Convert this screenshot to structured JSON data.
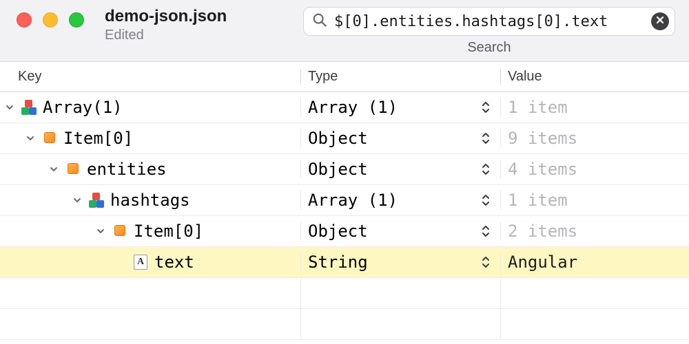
{
  "window": {
    "title": "demo-json.json",
    "subtitle": "Edited"
  },
  "search": {
    "value": "$[0].entities.hashtags[0].text",
    "label": "Search"
  },
  "columns": {
    "key": "Key",
    "type": "Type",
    "value": "Value"
  },
  "tree": [
    {
      "depth": 0,
      "icon": "cubes",
      "key": "Array(1)",
      "type": "Array (1)",
      "value": "1 item",
      "disclosure": true,
      "highlight": false,
      "strongValue": false
    },
    {
      "depth": 1,
      "icon": "box",
      "key": "Item[0]",
      "type": "Object",
      "value": "9 items",
      "disclosure": true,
      "highlight": false,
      "strongValue": false
    },
    {
      "depth": 2,
      "icon": "box",
      "key": "entities",
      "type": "Object",
      "value": "4 items",
      "disclosure": true,
      "highlight": false,
      "strongValue": false
    },
    {
      "depth": 3,
      "icon": "cubes",
      "key": "hashtags",
      "type": "Array (1)",
      "value": "1 item",
      "disclosure": true,
      "highlight": false,
      "strongValue": false
    },
    {
      "depth": 4,
      "icon": "box",
      "key": "Item[0]",
      "type": "Object",
      "value": "2 items",
      "disclosure": true,
      "highlight": false,
      "strongValue": false
    },
    {
      "depth": 5,
      "icon": "text",
      "key": "text",
      "type": "String",
      "value": "Angular",
      "disclosure": false,
      "highlight": true,
      "strongValue": true
    }
  ]
}
